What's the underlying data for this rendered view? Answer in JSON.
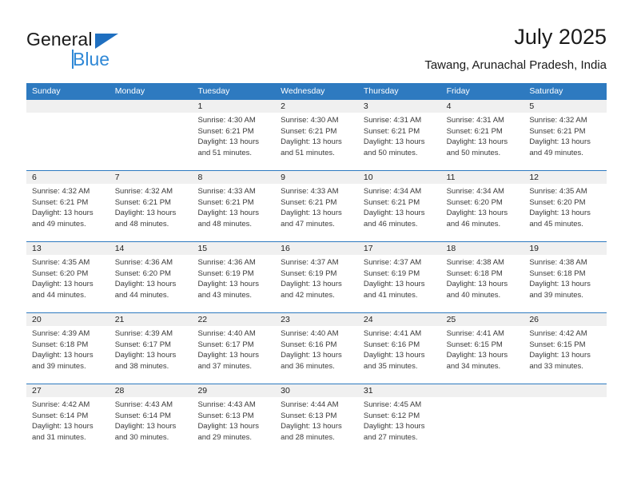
{
  "brand": {
    "word1": "General",
    "word2": "Blue",
    "triangle_color": "#1f6fc0",
    "word2_color": "#2f88d6"
  },
  "header": {
    "title": "July 2025",
    "subtitle": "Tawang, Arunachal Pradesh, India"
  },
  "theme": {
    "header_bg": "#2e7ac0",
    "header_text": "#ffffff",
    "daynum_band": "#f0f0f0",
    "row_divider": "#2e7ac0",
    "body_text": "#3a3a3a"
  },
  "calendar": {
    "weekdays": [
      "Sunday",
      "Monday",
      "Tuesday",
      "Wednesday",
      "Thursday",
      "Friday",
      "Saturday"
    ],
    "weeks": [
      [
        {
          "day": ""
        },
        {
          "day": ""
        },
        {
          "day": "1",
          "sunrise": "Sunrise: 4:30 AM",
          "sunset": "Sunset: 6:21 PM",
          "daylight1": "Daylight: 13 hours",
          "daylight2": "and 51 minutes."
        },
        {
          "day": "2",
          "sunrise": "Sunrise: 4:30 AM",
          "sunset": "Sunset: 6:21 PM",
          "daylight1": "Daylight: 13 hours",
          "daylight2": "and 51 minutes."
        },
        {
          "day": "3",
          "sunrise": "Sunrise: 4:31 AM",
          "sunset": "Sunset: 6:21 PM",
          "daylight1": "Daylight: 13 hours",
          "daylight2": "and 50 minutes."
        },
        {
          "day": "4",
          "sunrise": "Sunrise: 4:31 AM",
          "sunset": "Sunset: 6:21 PM",
          "daylight1": "Daylight: 13 hours",
          "daylight2": "and 50 minutes."
        },
        {
          "day": "5",
          "sunrise": "Sunrise: 4:32 AM",
          "sunset": "Sunset: 6:21 PM",
          "daylight1": "Daylight: 13 hours",
          "daylight2": "and 49 minutes."
        }
      ],
      [
        {
          "day": "6",
          "sunrise": "Sunrise: 4:32 AM",
          "sunset": "Sunset: 6:21 PM",
          "daylight1": "Daylight: 13 hours",
          "daylight2": "and 49 minutes."
        },
        {
          "day": "7",
          "sunrise": "Sunrise: 4:32 AM",
          "sunset": "Sunset: 6:21 PM",
          "daylight1": "Daylight: 13 hours",
          "daylight2": "and 48 minutes."
        },
        {
          "day": "8",
          "sunrise": "Sunrise: 4:33 AM",
          "sunset": "Sunset: 6:21 PM",
          "daylight1": "Daylight: 13 hours",
          "daylight2": "and 48 minutes."
        },
        {
          "day": "9",
          "sunrise": "Sunrise: 4:33 AM",
          "sunset": "Sunset: 6:21 PM",
          "daylight1": "Daylight: 13 hours",
          "daylight2": "and 47 minutes."
        },
        {
          "day": "10",
          "sunrise": "Sunrise: 4:34 AM",
          "sunset": "Sunset: 6:21 PM",
          "daylight1": "Daylight: 13 hours",
          "daylight2": "and 46 minutes."
        },
        {
          "day": "11",
          "sunrise": "Sunrise: 4:34 AM",
          "sunset": "Sunset: 6:20 PM",
          "daylight1": "Daylight: 13 hours",
          "daylight2": "and 46 minutes."
        },
        {
          "day": "12",
          "sunrise": "Sunrise: 4:35 AM",
          "sunset": "Sunset: 6:20 PM",
          "daylight1": "Daylight: 13 hours",
          "daylight2": "and 45 minutes."
        }
      ],
      [
        {
          "day": "13",
          "sunrise": "Sunrise: 4:35 AM",
          "sunset": "Sunset: 6:20 PM",
          "daylight1": "Daylight: 13 hours",
          "daylight2": "and 44 minutes."
        },
        {
          "day": "14",
          "sunrise": "Sunrise: 4:36 AM",
          "sunset": "Sunset: 6:20 PM",
          "daylight1": "Daylight: 13 hours",
          "daylight2": "and 44 minutes."
        },
        {
          "day": "15",
          "sunrise": "Sunrise: 4:36 AM",
          "sunset": "Sunset: 6:19 PM",
          "daylight1": "Daylight: 13 hours",
          "daylight2": "and 43 minutes."
        },
        {
          "day": "16",
          "sunrise": "Sunrise: 4:37 AM",
          "sunset": "Sunset: 6:19 PM",
          "daylight1": "Daylight: 13 hours",
          "daylight2": "and 42 minutes."
        },
        {
          "day": "17",
          "sunrise": "Sunrise: 4:37 AM",
          "sunset": "Sunset: 6:19 PM",
          "daylight1": "Daylight: 13 hours",
          "daylight2": "and 41 minutes."
        },
        {
          "day": "18",
          "sunrise": "Sunrise: 4:38 AM",
          "sunset": "Sunset: 6:18 PM",
          "daylight1": "Daylight: 13 hours",
          "daylight2": "and 40 minutes."
        },
        {
          "day": "19",
          "sunrise": "Sunrise: 4:38 AM",
          "sunset": "Sunset: 6:18 PM",
          "daylight1": "Daylight: 13 hours",
          "daylight2": "and 39 minutes."
        }
      ],
      [
        {
          "day": "20",
          "sunrise": "Sunrise: 4:39 AM",
          "sunset": "Sunset: 6:18 PM",
          "daylight1": "Daylight: 13 hours",
          "daylight2": "and 39 minutes."
        },
        {
          "day": "21",
          "sunrise": "Sunrise: 4:39 AM",
          "sunset": "Sunset: 6:17 PM",
          "daylight1": "Daylight: 13 hours",
          "daylight2": "and 38 minutes."
        },
        {
          "day": "22",
          "sunrise": "Sunrise: 4:40 AM",
          "sunset": "Sunset: 6:17 PM",
          "daylight1": "Daylight: 13 hours",
          "daylight2": "and 37 minutes."
        },
        {
          "day": "23",
          "sunrise": "Sunrise: 4:40 AM",
          "sunset": "Sunset: 6:16 PM",
          "daylight1": "Daylight: 13 hours",
          "daylight2": "and 36 minutes."
        },
        {
          "day": "24",
          "sunrise": "Sunrise: 4:41 AM",
          "sunset": "Sunset: 6:16 PM",
          "daylight1": "Daylight: 13 hours",
          "daylight2": "and 35 minutes."
        },
        {
          "day": "25",
          "sunrise": "Sunrise: 4:41 AM",
          "sunset": "Sunset: 6:15 PM",
          "daylight1": "Daylight: 13 hours",
          "daylight2": "and 34 minutes."
        },
        {
          "day": "26",
          "sunrise": "Sunrise: 4:42 AM",
          "sunset": "Sunset: 6:15 PM",
          "daylight1": "Daylight: 13 hours",
          "daylight2": "and 33 minutes."
        }
      ],
      [
        {
          "day": "27",
          "sunrise": "Sunrise: 4:42 AM",
          "sunset": "Sunset: 6:14 PM",
          "daylight1": "Daylight: 13 hours",
          "daylight2": "and 31 minutes."
        },
        {
          "day": "28",
          "sunrise": "Sunrise: 4:43 AM",
          "sunset": "Sunset: 6:14 PM",
          "daylight1": "Daylight: 13 hours",
          "daylight2": "and 30 minutes."
        },
        {
          "day": "29",
          "sunrise": "Sunrise: 4:43 AM",
          "sunset": "Sunset: 6:13 PM",
          "daylight1": "Daylight: 13 hours",
          "daylight2": "and 29 minutes."
        },
        {
          "day": "30",
          "sunrise": "Sunrise: 4:44 AM",
          "sunset": "Sunset: 6:13 PM",
          "daylight1": "Daylight: 13 hours",
          "daylight2": "and 28 minutes."
        },
        {
          "day": "31",
          "sunrise": "Sunrise: 4:45 AM",
          "sunset": "Sunset: 6:12 PM",
          "daylight1": "Daylight: 13 hours",
          "daylight2": "and 27 minutes."
        },
        {
          "day": ""
        },
        {
          "day": ""
        }
      ]
    ]
  }
}
